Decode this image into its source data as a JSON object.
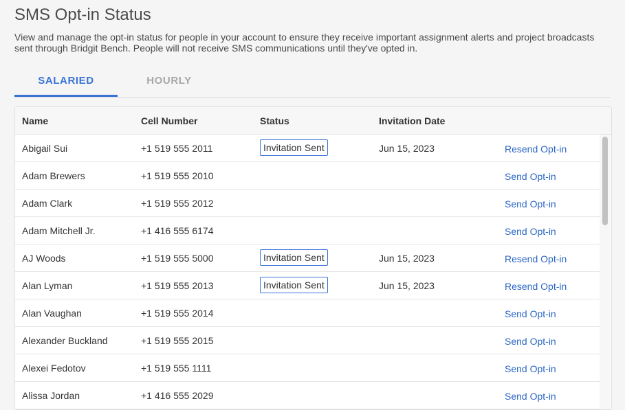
{
  "page": {
    "title": "SMS Opt-in Status",
    "description": "View and manage the opt-in status for people in your account to ensure they receive important assignment alerts and project broadcasts sent through Bridgit Bench. People will not receive SMS communications until they've opted in."
  },
  "tabs": [
    {
      "label": "SALARIED",
      "active": true
    },
    {
      "label": "HOURLY",
      "active": false
    }
  ],
  "table": {
    "headers": [
      "Name",
      "Cell Number",
      "Status",
      "Invitation Date"
    ],
    "rows": [
      {
        "name": "Abigail Sui",
        "cell": "+1 519 555 2011",
        "status": "Invitation Sent",
        "date": "Jun 15, 2023",
        "action": "Resend Opt-in"
      },
      {
        "name": "Adam Brewers",
        "cell": "+1 519 555 2010",
        "status": "",
        "date": "",
        "action": "Send Opt-in"
      },
      {
        "name": "Adam Clark",
        "cell": "+1 519 555 2012",
        "status": "",
        "date": "",
        "action": "Send Opt-in"
      },
      {
        "name": "Adam Mitchell Jr.",
        "cell": "+1 416 555 6174",
        "status": "",
        "date": "",
        "action": "Send Opt-in"
      },
      {
        "name": "AJ Woods",
        "cell": "+1 519 555 5000",
        "status": "Invitation Sent",
        "date": "Jun 15, 2023",
        "action": "Resend Opt-in"
      },
      {
        "name": "Alan Lyman",
        "cell": "+1 519 555 2013",
        "status": "Invitation Sent",
        "date": "Jun 15, 2023",
        "action": "Resend Opt-in"
      },
      {
        "name": "Alan Vaughan",
        "cell": "+1 519 555 2014",
        "status": "",
        "date": "",
        "action": "Send Opt-in"
      },
      {
        "name": "Alexander Buckland",
        "cell": "+1 519 555 2015",
        "status": "",
        "date": "",
        "action": "Send Opt-in"
      },
      {
        "name": "Alexei Fedotov",
        "cell": "+1 519 555 1111",
        "status": "",
        "date": "",
        "action": "Send Opt-in"
      },
      {
        "name": "Alissa Jordan",
        "cell": "+1 416 555 2029",
        "status": "",
        "date": "",
        "action": "Send Opt-in"
      }
    ]
  },
  "colors": {
    "accent": "#3a73d6",
    "link": "#2a66c4",
    "tab_inactive": "#a7a7a7"
  }
}
